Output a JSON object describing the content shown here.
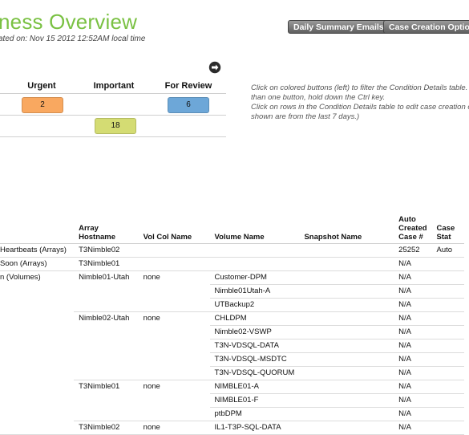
{
  "header": {
    "title": "ness Overview",
    "subtitle": "ated on: Nov 15 2012 12:52AM local time",
    "buttons": {
      "daily": "Daily Summary Emails...",
      "case": "Case Creation Options..."
    }
  },
  "severity": {
    "headers": [
      "Urgent",
      "Important",
      "For Review"
    ],
    "row1": {
      "urgent": "2",
      "review": "6"
    },
    "row2": {
      "important": "18"
    },
    "colors": {
      "urgent": "#f9a860",
      "important": "#d4dc73",
      "review": "#6da7d8"
    }
  },
  "help": {
    "lines": [
      "Click on colored buttons (left) to filter the Condition Details table. T",
      "than one button, hold down the Ctrl key.",
      "Click on rows in the Condition Details table to edit case creation op",
      "shown are from the last 7 days.)"
    ]
  },
  "table": {
    "headers": {
      "condition": "",
      "hostname": "Array Hostname",
      "volcol": "Vol Col Name",
      "volume": "Volume Name",
      "snapshot": "Snapshot Name",
      "auto": [
        "Auto",
        "Created",
        "Case #"
      ],
      "status": [
        "Case",
        "Stat"
      ]
    },
    "rows": [
      {
        "condition": "Heartbeats (Arrays)",
        "hostname": "T3Nimble02",
        "volcol": "",
        "volume": "",
        "snapshot": "",
        "case": "25252",
        "status": "Auto"
      },
      {
        "condition": " Soon (Arrays)",
        "hostname": "T3Nimble01",
        "volcol": "",
        "volume": "",
        "snapshot": "",
        "case": "N/A",
        "status": ""
      },
      {
        "condition": "n (Volumes)",
        "hostname": "Nimble01-Utah",
        "volcol": "none",
        "volume": "Customer-DPM",
        "snapshot": "",
        "case": "N/A",
        "status": ""
      },
      {
        "condition": "",
        "hostname": "",
        "volcol": "",
        "volume": "Nimble01Utah-A",
        "snapshot": "",
        "case": "N/A",
        "status": ""
      },
      {
        "condition": "",
        "hostname": "",
        "volcol": "",
        "volume": "UTBackup2",
        "snapshot": "",
        "case": "N/A",
        "status": ""
      },
      {
        "condition": "",
        "hostname": "Nimble02-Utah",
        "volcol": "none",
        "volume": "CHLDPM",
        "snapshot": "",
        "case": "N/A",
        "status": ""
      },
      {
        "condition": "",
        "hostname": "",
        "volcol": "",
        "volume": "Nimble02-VSWP",
        "snapshot": "",
        "case": "N/A",
        "status": ""
      },
      {
        "condition": "",
        "hostname": "",
        "volcol": "",
        "volume": "T3N-VDSQL-DATA",
        "snapshot": "",
        "case": "N/A",
        "status": ""
      },
      {
        "condition": "",
        "hostname": "",
        "volcol": "",
        "volume": "T3N-VDSQL-MSDTC",
        "snapshot": "",
        "case": "N/A",
        "status": ""
      },
      {
        "condition": "",
        "hostname": "",
        "volcol": "",
        "volume": "T3N-VDSQL-QUORUM",
        "snapshot": "",
        "case": "N/A",
        "status": ""
      },
      {
        "condition": "",
        "hostname": "T3Nimble01",
        "volcol": "none",
        "volume": "NIMBLE01-A",
        "snapshot": "",
        "case": "N/A",
        "status": ""
      },
      {
        "condition": "",
        "hostname": "",
        "volcol": "",
        "volume": "NIMBLE01-F",
        "snapshot": "",
        "case": "N/A",
        "status": ""
      },
      {
        "condition": "",
        "hostname": "",
        "volcol": "",
        "volume": "ptbDPM",
        "snapshot": "",
        "case": "N/A",
        "status": ""
      },
      {
        "condition": "",
        "hostname": "T3Nimble02",
        "volcol": "none",
        "volume": "IL1-T3P-SQL-DATA",
        "snapshot": "",
        "case": "N/A",
        "status": ""
      }
    ]
  }
}
